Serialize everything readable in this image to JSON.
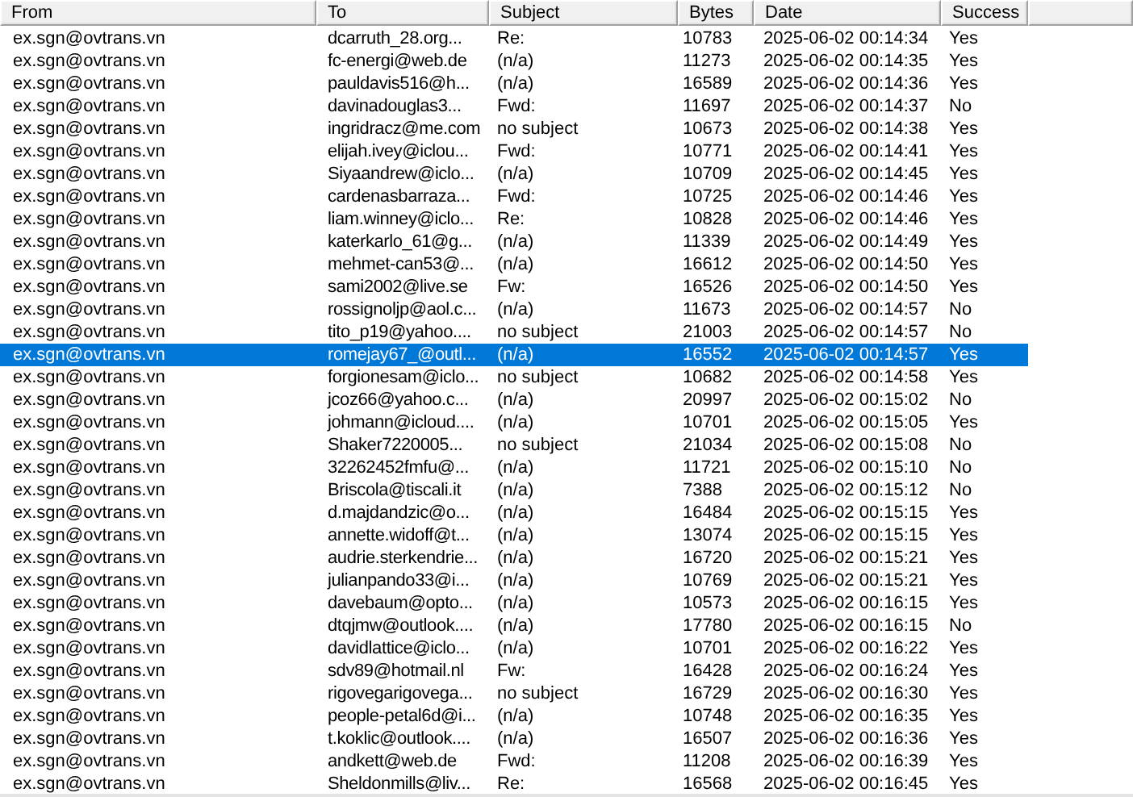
{
  "columns": [
    "From",
    "To",
    "Subject",
    "Bytes",
    "Date",
    "Success"
  ],
  "rows": [
    {
      "from": "ex.sgn@ovtrans.vn",
      "to": "dcarruth_28.org...",
      "subject": "Re:",
      "bytes": "10783",
      "date": "2025-06-02 00:14:34",
      "success": "Yes",
      "selected": false
    },
    {
      "from": "ex.sgn@ovtrans.vn",
      "to": "fc-energi@web.de",
      "subject": "(n/a)",
      "bytes": "11273",
      "date": "2025-06-02 00:14:35",
      "success": "Yes",
      "selected": false
    },
    {
      "from": "ex.sgn@ovtrans.vn",
      "to": "pauldavis516@h...",
      "subject": "(n/a)",
      "bytes": "16589",
      "date": "2025-06-02 00:14:36",
      "success": "Yes",
      "selected": false
    },
    {
      "from": "ex.sgn@ovtrans.vn",
      "to": "davinadouglas3...",
      "subject": "Fwd:",
      "bytes": "11697",
      "date": "2025-06-02 00:14:37",
      "success": "No",
      "selected": false
    },
    {
      "from": "ex.sgn@ovtrans.vn",
      "to": "ingridracz@me.com",
      "subject": "no subject",
      "bytes": "10673",
      "date": "2025-06-02 00:14:38",
      "success": "Yes",
      "selected": false
    },
    {
      "from": "ex.sgn@ovtrans.vn",
      "to": "elijah.ivey@iclou...",
      "subject": "Fwd:",
      "bytes": "10771",
      "date": "2025-06-02 00:14:41",
      "success": "Yes",
      "selected": false
    },
    {
      "from": "ex.sgn@ovtrans.vn",
      "to": "Siyaandrew@iclo...",
      "subject": "(n/a)",
      "bytes": "10709",
      "date": "2025-06-02 00:14:45",
      "success": "Yes",
      "selected": false
    },
    {
      "from": "ex.sgn@ovtrans.vn",
      "to": "cardenasbarraza...",
      "subject": "Fwd:",
      "bytes": "10725",
      "date": "2025-06-02 00:14:46",
      "success": "Yes",
      "selected": false
    },
    {
      "from": "ex.sgn@ovtrans.vn",
      "to": "liam.winney@iclo...",
      "subject": "Re:",
      "bytes": "10828",
      "date": "2025-06-02 00:14:46",
      "success": "Yes",
      "selected": false
    },
    {
      "from": "ex.sgn@ovtrans.vn",
      "to": "katerkarlo_61@g...",
      "subject": "(n/a)",
      "bytes": "11339",
      "date": "2025-06-02 00:14:49",
      "success": "Yes",
      "selected": false
    },
    {
      "from": "ex.sgn@ovtrans.vn",
      "to": "mehmet-can53@...",
      "subject": "(n/a)",
      "bytes": "16612",
      "date": "2025-06-02 00:14:50",
      "success": "Yes",
      "selected": false
    },
    {
      "from": "ex.sgn@ovtrans.vn",
      "to": "sami2002@live.se",
      "subject": "Fw:",
      "bytes": "16526",
      "date": "2025-06-02 00:14:50",
      "success": "Yes",
      "selected": false
    },
    {
      "from": "ex.sgn@ovtrans.vn",
      "to": "rossignoljp@aol.c...",
      "subject": "(n/a)",
      "bytes": "11673",
      "date": "2025-06-02 00:14:57",
      "success": "No",
      "selected": false
    },
    {
      "from": "ex.sgn@ovtrans.vn",
      "to": "tito_p19@yahoo....",
      "subject": "no subject",
      "bytes": "21003",
      "date": "2025-06-02 00:14:57",
      "success": "No",
      "selected": false
    },
    {
      "from": "ex.sgn@ovtrans.vn",
      "to": "romejay67_@outl...",
      "subject": "(n/a)",
      "bytes": "16552",
      "date": "2025-06-02 00:14:57",
      "success": "Yes",
      "selected": true
    },
    {
      "from": "ex.sgn@ovtrans.vn",
      "to": "forgionesam@iclo...",
      "subject": "no subject",
      "bytes": "10682",
      "date": "2025-06-02 00:14:58",
      "success": "Yes",
      "selected": false
    },
    {
      "from": "ex.sgn@ovtrans.vn",
      "to": "jcoz66@yahoo.c...",
      "subject": "(n/a)",
      "bytes": "20997",
      "date": "2025-06-02 00:15:02",
      "success": "No",
      "selected": false
    },
    {
      "from": "ex.sgn@ovtrans.vn",
      "to": "johmann@icloud....",
      "subject": "(n/a)",
      "bytes": "10701",
      "date": "2025-06-02 00:15:05",
      "success": "Yes",
      "selected": false
    },
    {
      "from": "ex.sgn@ovtrans.vn",
      "to": "Shaker7220005...",
      "subject": "no subject",
      "bytes": "21034",
      "date": "2025-06-02 00:15:08",
      "success": "No",
      "selected": false
    },
    {
      "from": "ex.sgn@ovtrans.vn",
      "to": "32262452fmfu@...",
      "subject": "(n/a)",
      "bytes": "11721",
      "date": "2025-06-02 00:15:10",
      "success": "No",
      "selected": false
    },
    {
      "from": "ex.sgn@ovtrans.vn",
      "to": "Briscola@tiscali.it",
      "subject": "(n/a)",
      "bytes": "7388",
      "date": "2025-06-02 00:15:12",
      "success": "No",
      "selected": false
    },
    {
      "from": "ex.sgn@ovtrans.vn",
      "to": "d.majdandzic@o...",
      "subject": "(n/a)",
      "bytes": "16484",
      "date": "2025-06-02 00:15:15",
      "success": "Yes",
      "selected": false
    },
    {
      "from": "ex.sgn@ovtrans.vn",
      "to": "annette.widoff@t...",
      "subject": "(n/a)",
      "bytes": "13074",
      "date": "2025-06-02 00:15:15",
      "success": "Yes",
      "selected": false
    },
    {
      "from": "ex.sgn@ovtrans.vn",
      "to": "audrie.sterkendrie...",
      "subject": "(n/a)",
      "bytes": "16720",
      "date": "2025-06-02 00:15:21",
      "success": "Yes",
      "selected": false
    },
    {
      "from": "ex.sgn@ovtrans.vn",
      "to": "julianpando33@i...",
      "subject": "(n/a)",
      "bytes": "10769",
      "date": "2025-06-02 00:15:21",
      "success": "Yes",
      "selected": false
    },
    {
      "from": "ex.sgn@ovtrans.vn",
      "to": "davebaum@opto...",
      "subject": "(n/a)",
      "bytes": "10573",
      "date": "2025-06-02 00:16:15",
      "success": "Yes",
      "selected": false
    },
    {
      "from": "ex.sgn@ovtrans.vn",
      "to": "dtqjmw@outlook....",
      "subject": "(n/a)",
      "bytes": "17780",
      "date": "2025-06-02 00:16:15",
      "success": "No",
      "selected": false
    },
    {
      "from": "ex.sgn@ovtrans.vn",
      "to": "davidlattice@iclo...",
      "subject": "(n/a)",
      "bytes": "10701",
      "date": "2025-06-02 00:16:22",
      "success": "Yes",
      "selected": false
    },
    {
      "from": "ex.sgn@ovtrans.vn",
      "to": "sdv89@hotmail.nl",
      "subject": "Fw:",
      "bytes": "16428",
      "date": "2025-06-02 00:16:24",
      "success": "Yes",
      "selected": false
    },
    {
      "from": "ex.sgn@ovtrans.vn",
      "to": "rigovegarigovega...",
      "subject": "no subject",
      "bytes": "16729",
      "date": "2025-06-02 00:16:30",
      "success": "Yes",
      "selected": false
    },
    {
      "from": "ex.sgn@ovtrans.vn",
      "to": "people-petal6d@i...",
      "subject": "(n/a)",
      "bytes": "10748",
      "date": "2025-06-02 00:16:35",
      "success": "Yes",
      "selected": false
    },
    {
      "from": "ex.sgn@ovtrans.vn",
      "to": "t.koklic@outlook....",
      "subject": "(n/a)",
      "bytes": "16507",
      "date": "2025-06-02 00:16:36",
      "success": "Yes",
      "selected": false
    },
    {
      "from": "ex.sgn@ovtrans.vn",
      "to": "andkett@web.de",
      "subject": "Fwd:",
      "bytes": "11208",
      "date": "2025-06-02 00:16:39",
      "success": "Yes",
      "selected": false
    },
    {
      "from": "ex.sgn@ovtrans.vn",
      "to": "Sheldonmills@liv...",
      "subject": "Re:",
      "bytes": "16568",
      "date": "2025-06-02 00:16:45",
      "success": "Yes",
      "selected": false
    }
  ]
}
